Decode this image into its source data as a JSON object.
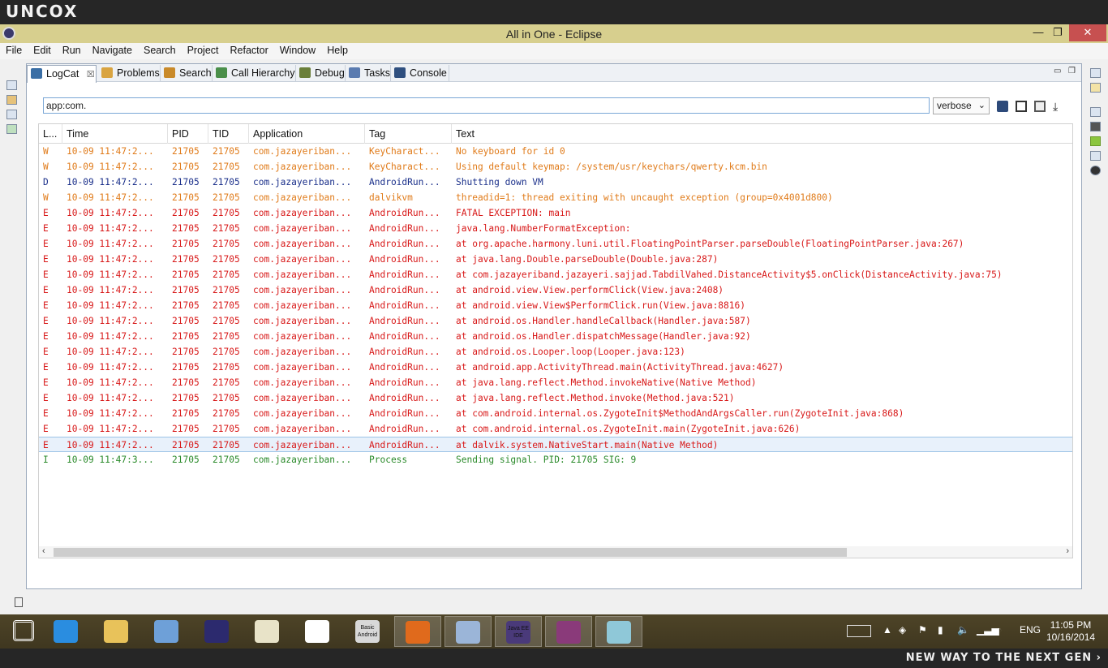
{
  "brand": {
    "logo": "UNCOX",
    "slogan": "NEW WAY TO THE NEXT GEN ›"
  },
  "window": {
    "title": "All in One - Eclipse",
    "min": "—",
    "max": "❐",
    "close": "✕"
  },
  "menu": [
    "File",
    "Edit",
    "Run",
    "Navigate",
    "Search",
    "Project",
    "Refactor",
    "Window",
    "Help"
  ],
  "tabs": [
    {
      "label": "LogCat",
      "icon": "logcat-icon",
      "color": "#3a6ea5",
      "close": "☒"
    },
    {
      "label": "Problems",
      "icon": "problems-icon",
      "color": "#d9a441"
    },
    {
      "label": "Search",
      "icon": "search-icon",
      "color": "#c98a2a"
    },
    {
      "label": "Call Hierarchy",
      "icon": "call-hierarchy-icon",
      "color": "#4a8f4a"
    },
    {
      "label": "Debug",
      "icon": "debug-icon",
      "color": "#6a7f3a"
    },
    {
      "label": "Tasks",
      "icon": "tasks-icon",
      "color": "#5a7bb0"
    },
    {
      "label": "Console",
      "icon": "console-icon",
      "color": "#2f4f7f"
    }
  ],
  "filter": {
    "value": "app:com.",
    "level": "verbose"
  },
  "columns": [
    "L...",
    "Time",
    "PID",
    "TID",
    "Application",
    "Tag",
    "Text"
  ],
  "colors": {
    "W": "#e07b1a",
    "D": "#1a2f8a",
    "E": "#d81919",
    "I": "#2a8a2a"
  },
  "rows": [
    {
      "l": "W",
      "time": "10-09 11:47:2...",
      "pid": "21705",
      "tid": "21705",
      "app": "com.jazayeriban...",
      "tag": "KeyCharact...",
      "text": "No keyboard for id 0"
    },
    {
      "l": "W",
      "time": "10-09 11:47:2...",
      "pid": "21705",
      "tid": "21705",
      "app": "com.jazayeriban...",
      "tag": "KeyCharact...",
      "text": "Using default keymap: /system/usr/keychars/qwerty.kcm.bin"
    },
    {
      "l": "D",
      "time": "10-09 11:47:2...",
      "pid": "21705",
      "tid": "21705",
      "app": "com.jazayeriban...",
      "tag": "AndroidRun...",
      "text": "Shutting down VM"
    },
    {
      "l": "W",
      "time": "10-09 11:47:2...",
      "pid": "21705",
      "tid": "21705",
      "app": "com.jazayeriban...",
      "tag": "dalvikvm",
      "text": "threadid=1: thread exiting with uncaught exception (group=0x4001d800)"
    },
    {
      "l": "E",
      "time": "10-09 11:47:2...",
      "pid": "21705",
      "tid": "21705",
      "app": "com.jazayeriban...",
      "tag": "AndroidRun...",
      "text": "FATAL EXCEPTION: main"
    },
    {
      "l": "E",
      "time": "10-09 11:47:2...",
      "pid": "21705",
      "tid": "21705",
      "app": "com.jazayeriban...",
      "tag": "AndroidRun...",
      "text": "java.lang.NumberFormatException:"
    },
    {
      "l": "E",
      "time": "10-09 11:47:2...",
      "pid": "21705",
      "tid": "21705",
      "app": "com.jazayeriban...",
      "tag": "AndroidRun...",
      "text": "at org.apache.harmony.luni.util.FloatingPointParser.parseDouble(FloatingPointParser.java:267)"
    },
    {
      "l": "E",
      "time": "10-09 11:47:2...",
      "pid": "21705",
      "tid": "21705",
      "app": "com.jazayeriban...",
      "tag": "AndroidRun...",
      "text": "at java.lang.Double.parseDouble(Double.java:287)"
    },
    {
      "l": "E",
      "time": "10-09 11:47:2...",
      "pid": "21705",
      "tid": "21705",
      "app": "com.jazayeriban...",
      "tag": "AndroidRun...",
      "text": "at com.jazayeriband.jazayeri.sajjad.TabdilVahed.DistanceActivity$5.onClick(DistanceActivity.java:75)"
    },
    {
      "l": "E",
      "time": "10-09 11:47:2...",
      "pid": "21705",
      "tid": "21705",
      "app": "com.jazayeriban...",
      "tag": "AndroidRun...",
      "text": "at android.view.View.performClick(View.java:2408)"
    },
    {
      "l": "E",
      "time": "10-09 11:47:2...",
      "pid": "21705",
      "tid": "21705",
      "app": "com.jazayeriban...",
      "tag": "AndroidRun...",
      "text": "at android.view.View$PerformClick.run(View.java:8816)"
    },
    {
      "l": "E",
      "time": "10-09 11:47:2...",
      "pid": "21705",
      "tid": "21705",
      "app": "com.jazayeriban...",
      "tag": "AndroidRun...",
      "text": "at android.os.Handler.handleCallback(Handler.java:587)"
    },
    {
      "l": "E",
      "time": "10-09 11:47:2...",
      "pid": "21705",
      "tid": "21705",
      "app": "com.jazayeriban...",
      "tag": "AndroidRun...",
      "text": "at android.os.Handler.dispatchMessage(Handler.java:92)"
    },
    {
      "l": "E",
      "time": "10-09 11:47:2...",
      "pid": "21705",
      "tid": "21705",
      "app": "com.jazayeriban...",
      "tag": "AndroidRun...",
      "text": "at android.os.Looper.loop(Looper.java:123)"
    },
    {
      "l": "E",
      "time": "10-09 11:47:2...",
      "pid": "21705",
      "tid": "21705",
      "app": "com.jazayeriban...",
      "tag": "AndroidRun...",
      "text": "at android.app.ActivityThread.main(ActivityThread.java:4627)"
    },
    {
      "l": "E",
      "time": "10-09 11:47:2...",
      "pid": "21705",
      "tid": "21705",
      "app": "com.jazayeriban...",
      "tag": "AndroidRun...",
      "text": "at java.lang.reflect.Method.invokeNative(Native Method)"
    },
    {
      "l": "E",
      "time": "10-09 11:47:2...",
      "pid": "21705",
      "tid": "21705",
      "app": "com.jazayeriban...",
      "tag": "AndroidRun...",
      "text": "at java.lang.reflect.Method.invoke(Method.java:521)"
    },
    {
      "l": "E",
      "time": "10-09 11:47:2...",
      "pid": "21705",
      "tid": "21705",
      "app": "com.jazayeriban...",
      "tag": "AndroidRun...",
      "text": "at com.android.internal.os.ZygoteInit$MethodAndArgsCaller.run(ZygoteInit.java:868)"
    },
    {
      "l": "E",
      "time": "10-09 11:47:2...",
      "pid": "21705",
      "tid": "21705",
      "app": "com.jazayeriban...",
      "tag": "AndroidRun...",
      "text": "at com.android.internal.os.ZygoteInit.main(ZygoteInit.java:626)"
    },
    {
      "l": "E",
      "time": "10-09 11:47:2...",
      "pid": "21705",
      "tid": "21705",
      "app": "com.jazayeriban...",
      "tag": "AndroidRun...",
      "text": "at dalvik.system.NativeStart.main(Native Method)",
      "selected": true
    },
    {
      "l": "I",
      "time": "10-09 11:47:3...",
      "pid": "21705",
      "tid": "21705",
      "app": "com.jazayeriban...",
      "tag": "Process",
      "text": "Sending signal. PID: 21705 SIG: 9"
    }
  ],
  "taskbar": [
    {
      "name": "start-icon",
      "color": "#ffffff"
    },
    {
      "name": "internet-explorer-icon",
      "color": "#2a8de0"
    },
    {
      "name": "file-explorer-icon",
      "color": "#e8c25a"
    },
    {
      "name": "scanner-icon",
      "color": "#6ea0d8"
    },
    {
      "name": "eclipse-icon",
      "color": "#2c2a6e"
    },
    {
      "name": "wordpad-icon",
      "color": "#e8e3c8"
    },
    {
      "name": "notepad-icon",
      "color": "#ffffff"
    },
    {
      "name": "basic-android-icon",
      "color": "#d8d8d8",
      "label": "Basic Android"
    },
    {
      "name": "firefox-icon",
      "color": "#e06a1c",
      "active": true
    },
    {
      "name": "window-app-icon",
      "color": "#9bb5d8",
      "active": true
    },
    {
      "name": "java-ee-ide-icon",
      "color": "#4a3a7a",
      "active": true,
      "label": "Java EE IDE"
    },
    {
      "name": "winrar-icon",
      "color": "#8a3a7a",
      "active": true
    },
    {
      "name": "notebook-icon",
      "color": "#8fc8d8",
      "active": true
    }
  ],
  "tray": {
    "lang": "ENG",
    "time": "11:05 PM",
    "date": "10/16/2014"
  }
}
